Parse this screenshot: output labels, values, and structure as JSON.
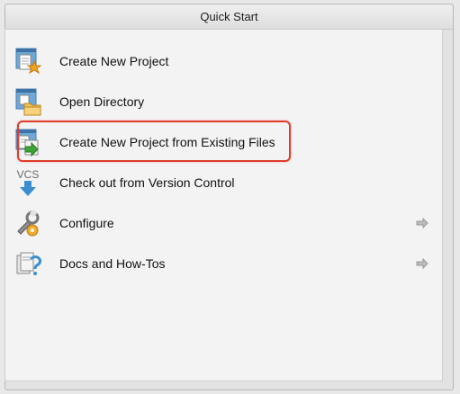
{
  "header": {
    "title": "Quick Start"
  },
  "items": [
    {
      "label": "Create New Project",
      "icon": "new-project-icon",
      "has_arrow": false
    },
    {
      "label": "Open Directory",
      "icon": "open-directory-icon",
      "has_arrow": false
    },
    {
      "label": "Create New Project from Existing Files",
      "icon": "import-project-icon",
      "has_arrow": false,
      "highlighted": true
    },
    {
      "label": "Check out from Version Control",
      "icon": "vcs-icon",
      "icon_text": "VCS",
      "has_arrow": false
    },
    {
      "label": "Configure",
      "icon": "configure-icon",
      "has_arrow": true
    },
    {
      "label": "Docs and How-Tos",
      "icon": "docs-icon",
      "has_arrow": true
    }
  ],
  "colors": {
    "highlight": "#e03b2b",
    "accent_blue": "#3a8fd0",
    "accent_green": "#3ca335"
  }
}
